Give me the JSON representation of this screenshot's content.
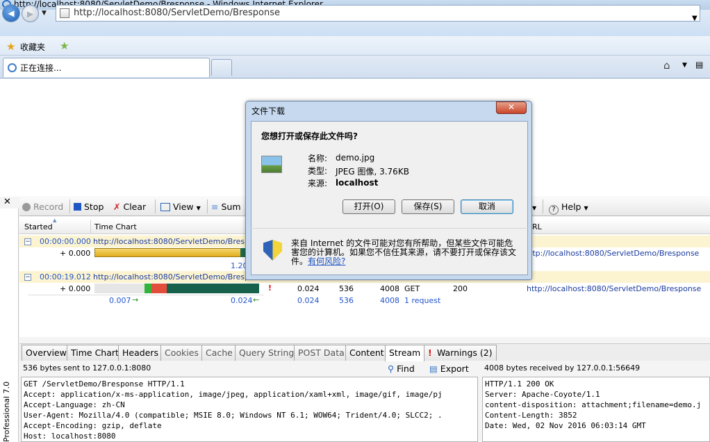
{
  "window": {
    "title": "http://localhost:8080/ServletDemo/Bresponse - Windows Internet Explorer"
  },
  "browser": {
    "address": "http://localhost:8080/ServletDemo/Bresponse",
    "favorites_label": "收藏夹",
    "tab_label": "正在连接..."
  },
  "fiddler": {
    "side_label": "Professional 7.0",
    "toolbar": {
      "record": "Record",
      "stop": "Stop",
      "clear": "Clear",
      "view": "View",
      "summary": "Sum",
      "help": "Help"
    },
    "grid_headers": {
      "started": "Started",
      "timechart": "Time Chart",
      "url": "RL"
    },
    "groups": [
      {
        "started": "00:00:00.000",
        "url": "http://localhost:8080/ServletDemo/Bresponse",
        "offset": "+ 0.000",
        "right_url": "ttp://localhost:8080/ServletDemo/Bresponse",
        "scale_left": "1.20"
      },
      {
        "started": "00:00:19.012",
        "url": "http://localhost:8080/ServletDemo/Bresponse",
        "offset": "+ 0.000",
        "flag": "!",
        "time": "0.024",
        "sent": "536",
        "received": "4008",
        "method": "GET",
        "status": "200",
        "right_url": "http://localhost:8080/ServletDemo/Bresponse",
        "scale_left": "0.007",
        "scale_right": "0.024",
        "sum_time": "0.024",
        "sum_sent": "536",
        "sum_received": "4008",
        "sum_requests": "1 request"
      }
    ],
    "detail_tabs": [
      "Overview",
      "Time Chart",
      "Headers",
      "Cookies",
      "Cache",
      "Query String",
      "POST Data",
      "Content",
      "Stream",
      "Warnings (2)"
    ],
    "active_tab": "Stream",
    "request_info": "536 bytes sent to 127.0.0.1:8080",
    "response_info": "4008 bytes received by 127.0.0.1:56649",
    "find": "Find",
    "export": "Export",
    "request_lines": [
      "GET /ServletDemo/Bresponse HTTP/1.1",
      "Accept: application/x-ms-application, image/jpeg, application/xaml+xml, image/gif, image/pj",
      "Accept-Language: zh-CN",
      "User-Agent: Mozilla/4.0 (compatible; MSIE 8.0; Windows NT 6.1; WOW64; Trident/4.0; SLCC2; .",
      "Accept-Encoding: gzip, deflate",
      "Host: localhost:8080"
    ],
    "response_lines": [
      "HTTP/1.1 200 OK",
      "Server: Apache-Coyote/1.1",
      "content-disposition: attachment;filename=demo.j",
      "Content-Length: 3852",
      "Date: Wed, 02 Nov 2016 06:03:14 GMT"
    ]
  },
  "dialog": {
    "title": "文件下载",
    "question": "您想打开或保存此文件吗?",
    "name_label": "名称:",
    "name_value": "demo.jpg",
    "type_label": "类型:",
    "type_value": "JPEG 图像, 3.76KB",
    "source_label": "来源:",
    "source_value": "localhost",
    "open_button": "打开(O)",
    "save_button": "保存(S)",
    "cancel_button": "取消",
    "warning_text": "来自 Internet 的文件可能对您有所帮助，但某些文件可能危害您的计算机。如果您不信任其来源，请不要打开或保存该文件。",
    "warning_link": "有何风险?"
  }
}
